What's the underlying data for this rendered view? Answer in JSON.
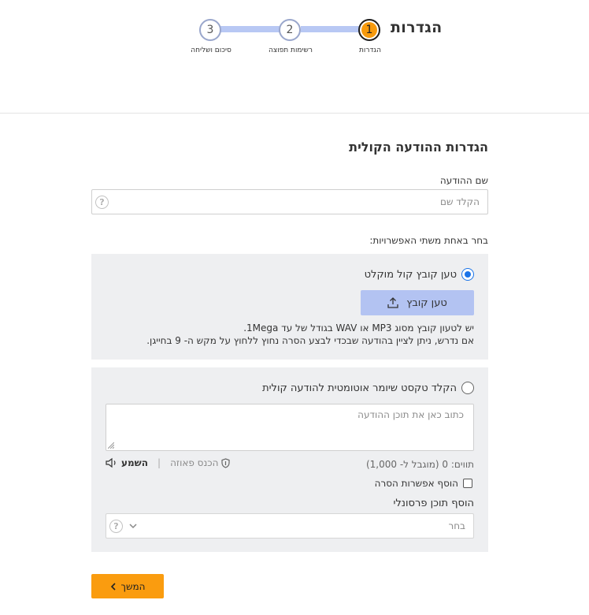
{
  "header": {
    "title": "הגדרות",
    "steps": [
      {
        "number": "1",
        "label": "הגדרות",
        "active": true
      },
      {
        "number": "2",
        "label": "רשימות תפוצה",
        "active": false
      },
      {
        "number": "3",
        "label": "סיכום ושליחה",
        "active": false
      }
    ]
  },
  "form": {
    "section_title": "הגדרות ההודעה הקולית",
    "name_label": "שם ההודעה",
    "name_placeholder": "הקלד שם",
    "name_value": "",
    "choose_label": "בחר באחת משתי האפשרויות:",
    "option_upload": {
      "label": "טען קובץ קול מוקלט",
      "selected": true,
      "button_label": "טען קובץ",
      "info_line1": "יש לטעון קובץ מסוג MP3 או WAV בגודל של עד 1Mega.",
      "info_line2": "אם נדרש, ניתן לציין בהודעה שבכדי לבצע הסרה נחוץ ללחוץ על מקש ה- 9 בחייגן."
    },
    "option_text": {
      "label": "הקלד טקסט שיומר אוטומטית להודעה קולית",
      "selected": false,
      "textarea_placeholder": "כתוב כאן את תוכן ההודעה",
      "char_count": "תווים: 0 (מוגבל ל- 1,000)",
      "pause_label": "הכנס פאוזה",
      "listen_label": "השמע",
      "remove_option_label": "הוסף אפשרות הסרה",
      "personal_label": "הוסף תוכן פרסונלי",
      "select_value": "בחר"
    },
    "continue_label": "המשך"
  },
  "colors": {
    "accent_orange": "#f79a0c",
    "step_track": "#b8c8f4",
    "upload_button": "#b3c3f2",
    "panel_bg": "#eeeff1",
    "radio_blue": "#1a73e8"
  }
}
